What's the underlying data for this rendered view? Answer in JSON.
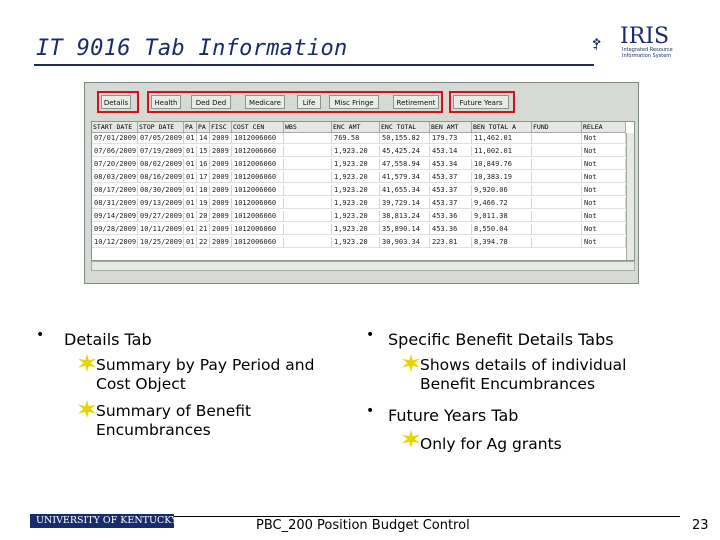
{
  "slide": {
    "title": "IT 9016 Tab Information",
    "footer": "PBC_200 Position Budget Control",
    "page_number": "23"
  },
  "logo": {
    "text": "IRIS",
    "subtitle": "Integrated Resource Information System"
  },
  "uk_logo": {
    "text": "UNIVERSITY OF KENTUCKY"
  },
  "tabs": [
    "Details",
    "Health",
    "Ded Ded",
    "Medicare",
    "Life",
    "Misc Fringe",
    "Retirement",
    "Future Years"
  ],
  "table": {
    "headers": [
      "START DATE",
      "STOP DATE",
      "PA",
      "PA",
      "FISC",
      "COST CEN",
      "WBS",
      "ENC AMT",
      "ENC TOTAL",
      "BEN AMT",
      "BEN TOTAL A",
      "FUND",
      "RELEA"
    ],
    "rows": [
      [
        "07/01/2009",
        "07/05/2009",
        "01",
        "14",
        "2009",
        "1012006060",
        "",
        "769.58",
        "50,155.82",
        "179.73",
        "11,462.01",
        "",
        "Not"
      ],
      [
        "07/06/2009",
        "07/19/2009",
        "01",
        "15",
        "2009",
        "1012006060",
        "",
        "1,923.20",
        "45,425.24",
        "453.14",
        "11,002.01",
        "",
        "Not"
      ],
      [
        "07/20/2009",
        "08/02/2009",
        "01",
        "16",
        "2009",
        "1012006060",
        "",
        "1,923.20",
        "47,558.94",
        "453.34",
        "10,849.76",
        "",
        "Not"
      ],
      [
        "08/03/2009",
        "08/16/2009",
        "01",
        "17",
        "2009",
        "1012006060",
        "",
        "1,923.20",
        "41,579.34",
        "453.37",
        "10,383.19",
        "",
        "Not"
      ],
      [
        "08/17/2009",
        "08/30/2009",
        "01",
        "18",
        "2009",
        "1012006060",
        "",
        "1,923.20",
        "41,655.34",
        "453.37",
        "9,920.06",
        "",
        "Not"
      ],
      [
        "08/31/2009",
        "09/13/2009",
        "01",
        "19",
        "2009",
        "1012006060",
        "",
        "1,923.20",
        "39,729.14",
        "453.37",
        "9,466.72",
        "",
        "Not"
      ],
      [
        "09/14/2009",
        "09/27/2009",
        "01",
        "20",
        "2009",
        "1012006060",
        "",
        "1,923.20",
        "38,813.24",
        "453.36",
        "9,011.38",
        "",
        "Not"
      ],
      [
        "09/28/2009",
        "10/11/2009",
        "01",
        "21",
        "2009",
        "1012006060",
        "",
        "1,923.20",
        "35,890.14",
        "453.36",
        "8,550.04",
        "",
        "Not"
      ],
      [
        "10/12/2009",
        "10/25/2009",
        "01",
        "22",
        "2009",
        "1012006060",
        "",
        "1,923.20",
        "30,903.34",
        "223.81",
        "8,394.78",
        "",
        "Not"
      ]
    ]
  },
  "bullets_left": {
    "main": "Details Tab",
    "subs": [
      [
        "Summary by Pay Period and",
        "Cost Object"
      ],
      [
        "Summary of Benefit",
        "Encumbrances"
      ]
    ]
  },
  "bullets_right": [
    {
      "main": "Specific Benefit Details Tabs",
      "subs": [
        [
          "Shows details of individual",
          "Benefit Encumbrances"
        ]
      ]
    },
    {
      "main": "Future Years Tab",
      "subs": [
        [
          "Only for Ag grants"
        ]
      ]
    }
  ],
  "colors": {
    "title": "#1a2b6b",
    "highlight": "#d4121a",
    "star": "#e8d400"
  }
}
